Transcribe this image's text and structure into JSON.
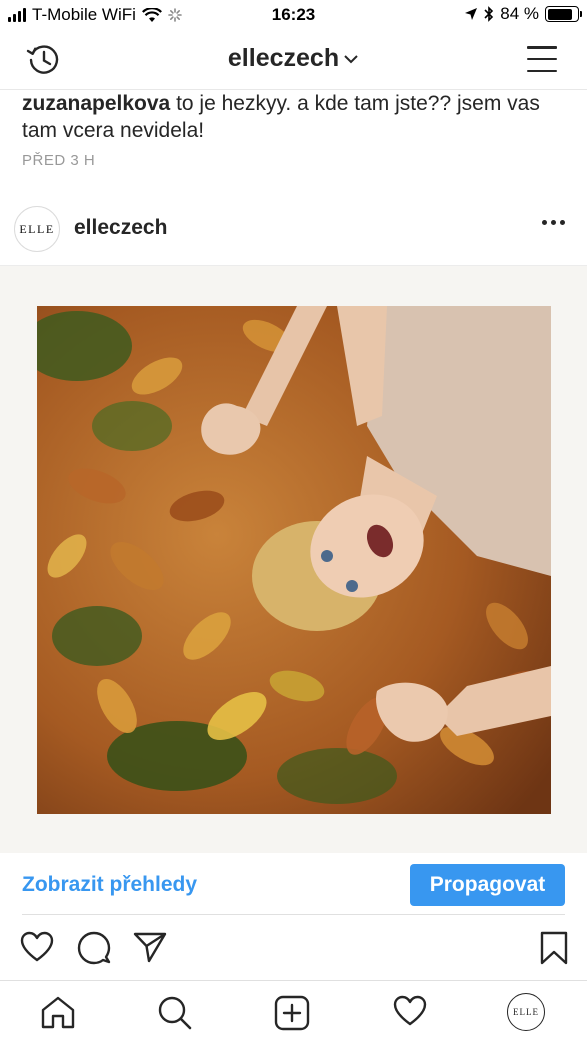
{
  "status_bar": {
    "carrier": "T-Mobile WiFi",
    "time": "16:23",
    "battery_percent": "84 %",
    "battery_level": 0.84
  },
  "header": {
    "title": "elleczech"
  },
  "comment": {
    "username": "zuzanapelkova",
    "text": "to je hezkyy. a kde tam jste?? jsem vas tam vcera nevidela!",
    "time": "PŘED 3 H"
  },
  "post": {
    "avatar_text": "ELLE",
    "username": "elleczech"
  },
  "actions": {
    "insights_label": "Zobrazit přehledy",
    "promote_label": "Propagovat"
  },
  "tab_bar": {
    "avatar_text": "ELLE"
  },
  "colors": {
    "accent": "#3897f0",
    "text": "#262626",
    "muted": "#999999"
  }
}
